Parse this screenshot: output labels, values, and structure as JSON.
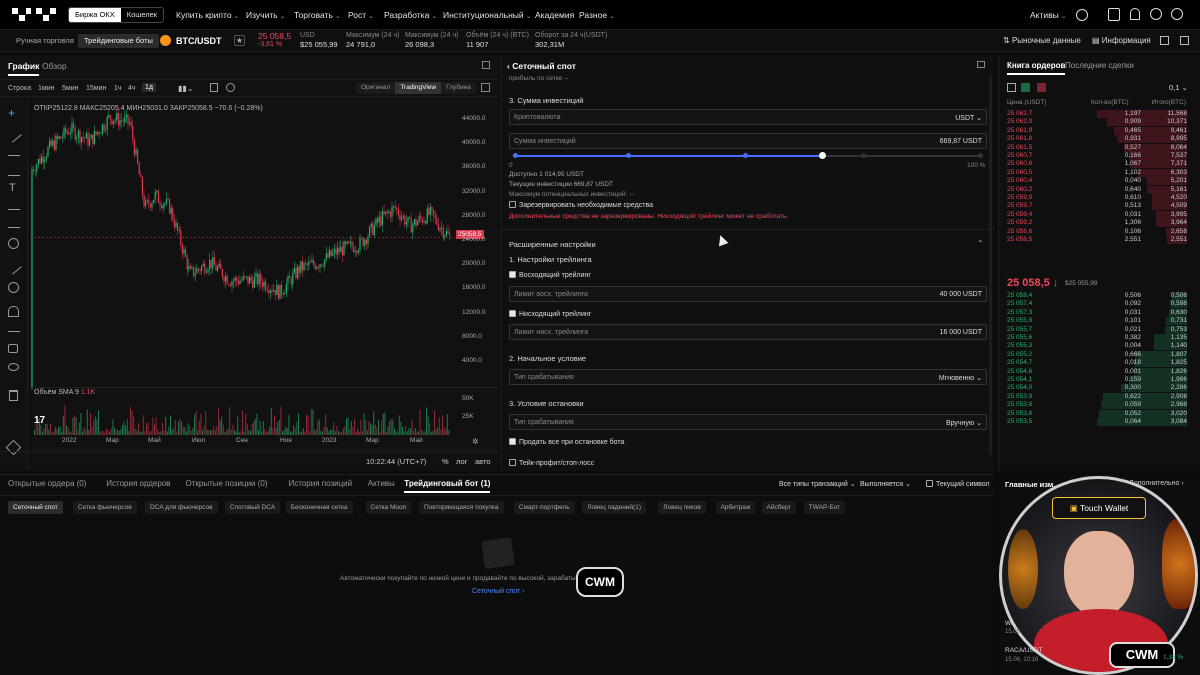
{
  "nav": {
    "switch": [
      "Биржа ОКХ",
      "Кошелек"
    ],
    "items": [
      "Купить крипто",
      "Изучить",
      "Торговать",
      "Рост",
      "Разработка",
      "Институциональный",
      "Академия",
      "Разное"
    ],
    "assets": "Активы"
  },
  "ticker": {
    "modes": [
      "Ручная торговля",
      "Трейдинговые боты"
    ],
    "pair": "BTC/USDT",
    "price": "25 058,5",
    "change": "-3,61 %",
    "usd_label": "USD",
    "usd_value": "$25 055,99",
    "max_label": "Максимум (24 ч)",
    "max_value": "24 791,0",
    "maxb_label": "Максимум (24 ч)",
    "maxb_value": "26 098,3",
    "vol_label": "Объём (24 ч) (BTC)",
    "vol_value": "11 907",
    "turn_label": "Оборот за 24 ч(USDT)",
    "turn_value": "302,31M",
    "market_data": "Рыночные данные",
    "info": "Информация"
  },
  "chart": {
    "tabs": [
      "График",
      "Обзор"
    ],
    "intervals": [
      "Строка",
      "1мин",
      "5мин",
      "15мин",
      "1ч",
      "4ч",
      "1д"
    ],
    "views": [
      "Оригинал",
      "TradingView",
      "Глубина"
    ],
    "ohlc": "ОТКР25122.8  МАКС25205.4  МИН25031.0  ЗАКР25058.5  −70.6 (−0.28%)",
    "price_tag": "25058.5",
    "yticks": [
      "44000.0",
      "40000.0",
      "36000.0",
      "32000.0",
      "28000.0",
      "24000.0",
      "20000.0",
      "16000.0",
      "12000.0",
      "8000.0",
      "4000.0"
    ],
    "xticks": [
      "2022",
      "Мар",
      "Май",
      "Июл",
      "Сен",
      "Ноя",
      "2023",
      "Мар",
      "Май"
    ],
    "vol_label": "Объём SMA 9",
    "vol_value": "1.1K",
    "vol_ticks": [
      "50K",
      "25K"
    ],
    "clock": "10:22:44 (UTC+7)",
    "scale": [
      "%",
      "лог",
      "авто"
    ]
  },
  "bot": {
    "title": "Сеточный спот",
    "prev": "прибыль по сетке --",
    "s3": "3. Сумма инвестиций",
    "crypto_l": "Криптовалюта",
    "crypto_r": "USDT",
    "amount_l": "Сумма инвестиций",
    "amount_r": "669,87  USDT",
    "s_min": "0",
    "s_max": "100 %",
    "avail": "Доступно 1 014,95 USDT",
    "current": "Текущие инвестиции 669,87 USDT",
    "maxpot": "Максимум потенциальных инвестиций: --",
    "reserve": "Зарезервировать необходимые средства",
    "warning": "Дополнительные средства не зарезервированы. Нисходящий трейлинг может не сработать.",
    "adv": "Расширенные настройки",
    "s1": "1. Настройки трейлинга",
    "up": "Восходящий трейлинг",
    "up_l": "Лимит восх. трейлинга",
    "up_r": "40 000  USDT",
    "down": "Нисходящий трейлинг",
    "down_l": "Лимит нисх. трейлинга",
    "down_r": "16 000  USDT",
    "s2": "2. Начальное условие",
    "trig_l": "Тип срабатывания",
    "trig_r": "Мгновенно",
    "s3b": "3. Условие остановки",
    "stop_l": "Тип срабатывания",
    "stop_r": "Вручную",
    "sell": "Продать все при остановке бота",
    "tp": "Тейк-профит/стоп-лосс"
  },
  "ob": {
    "tabs": [
      "Книга ордеров",
      "Последние сделки"
    ],
    "step": "0,1",
    "headers": [
      "Цена (USDT)",
      "Кол-во(BTC)",
      "Итого(BTC)"
    ],
    "asks": [
      [
        "25 062,7",
        "1,197",
        "11,568"
      ],
      [
        "25 062,0",
        "0,909",
        "10,371"
      ],
      [
        "25 061,9",
        "0,465",
        "9,461"
      ],
      [
        "25 061,8",
        "0,931",
        "8,995"
      ],
      [
        "25 061,5",
        "0,527",
        "8,064"
      ],
      [
        "25 060,7",
        "0,166",
        "7,537"
      ],
      [
        "25 060,6",
        "1,067",
        "7,371"
      ],
      [
        "25 060,5",
        "1,102",
        "6,303"
      ],
      [
        "25 060,4",
        "0,040",
        "5,201"
      ],
      [
        "25 060,2",
        "0,640",
        "5,161"
      ],
      [
        "25 059,9",
        "0,610",
        "4,520"
      ],
      [
        "25 059,7",
        "0,513",
        "4,509"
      ],
      [
        "25 059,4",
        "0,031",
        "3,995"
      ],
      [
        "25 059,2",
        "1,306",
        "3,964"
      ],
      [
        "25 058,6",
        "0,106",
        "2,658"
      ],
      [
        "25 058,5",
        "2,551",
        "2,551"
      ]
    ],
    "mid": "25 058,5",
    "mid_usd": "$25 055,99",
    "bids": [
      [
        "25 058,4",
        "0,506",
        "0,506"
      ],
      [
        "25 057,4",
        "0,092",
        "0,598"
      ],
      [
        "25 057,3",
        "0,031",
        "0,630"
      ],
      [
        "25 055,9",
        "0,101",
        "0,731"
      ],
      [
        "25 055,7",
        "0,021",
        "0,753"
      ],
      [
        "25 055,6",
        "0,382",
        "1,135"
      ],
      [
        "25 055,3",
        "0,004",
        "1,140"
      ],
      [
        "25 055,2",
        "0,666",
        "1,807"
      ],
      [
        "25 054,7",
        "0,018",
        "1,825"
      ],
      [
        "25 054,6",
        "0,001",
        "1,826"
      ],
      [
        "25 054,1",
        "0,159",
        "1,986"
      ],
      [
        "25 054,0",
        "0,300",
        "2,286"
      ],
      [
        "25 053,9",
        "0,622",
        "2,908"
      ],
      [
        "25 053,8",
        "0,059",
        "2,968"
      ],
      [
        "25 053,6",
        "0,052",
        "3,020"
      ],
      [
        "25 053,5",
        "0,064",
        "3,084"
      ]
    ]
  },
  "bottom": {
    "tabs": [
      "Открытые ордера (0)",
      "История ордеров",
      "Открытые позиции (0)",
      "История позиций",
      "Активы",
      "Трейдинговый бот (1)"
    ],
    "filter1": "Все типы транзакций",
    "filter2": "Выполняется",
    "current_symbol": "Текущий символ",
    "chips": [
      "Сеточный спот",
      "Сетка фьючерсов",
      "DCA для фьючерсов",
      "Спотовый DCA",
      "Бесконечная сетка",
      "Сетка Moon",
      "Повторяющаяся покупка",
      "Смарт-портфель",
      "Ловец падений(1)",
      "Ловец пиков",
      "Арбитраж",
      "Айсберг",
      "TWAP-Бот"
    ],
    "empty": "Автоматически покупайте по низкой цене и продавайте по высокой, зарабатывая ... сти цен.",
    "link": "Сеточный спот ›"
  },
  "webcam": {
    "top_label": "Главные изм...",
    "top_right": "Дополнительно ›",
    "badge": "Touch Wallet",
    "logo": "CWM",
    "raca": "RACA/USDT",
    "raca_date": "15.06, 10:16",
    "raca_pct": "1,33 %",
    "w_label": "W...",
    "w_date": "15.06"
  }
}
